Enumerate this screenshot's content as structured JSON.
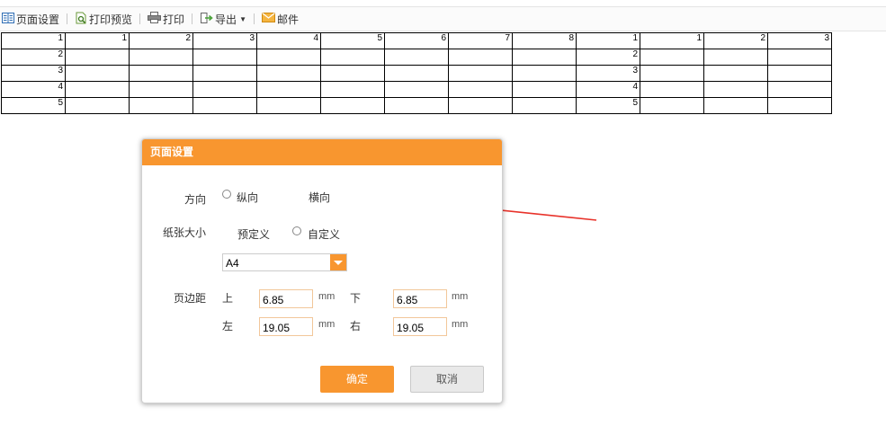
{
  "toolbar": {
    "page_setup": "页面设置",
    "print_preview": "打印预览",
    "print": "打印",
    "export": "导出",
    "mail": "邮件"
  },
  "grid": {
    "rows": [
      [
        "1",
        "1",
        "2",
        "3",
        "4",
        "5",
        "6",
        "7",
        "8",
        "1",
        "1",
        "2",
        "3"
      ],
      [
        "2",
        "",
        "",
        "",
        "",
        "",
        "",
        "",
        "",
        "2",
        "",
        "",
        ""
      ],
      [
        "3",
        "",
        "",
        "",
        "",
        "",
        "",
        "",
        "",
        "3",
        "",
        "",
        ""
      ],
      [
        "4",
        "",
        "",
        "",
        "",
        "",
        "",
        "",
        "",
        "4",
        "",
        "",
        ""
      ],
      [
        "5",
        "",
        "",
        "",
        "",
        "",
        "",
        "",
        "",
        "5",
        "",
        "",
        ""
      ]
    ]
  },
  "dialog": {
    "title": "页面设置",
    "orientation_label": "方向",
    "portrait": "纵向",
    "landscape": "横向",
    "paper_size_label": "纸张大小",
    "predefined": "预定义",
    "custom": "自定义",
    "paper_selected": "A4",
    "margin_label": "页边距",
    "top_label": "上",
    "bottom_label": "下",
    "left_label": "左",
    "right_label": "右",
    "top_value": "6.85",
    "bottom_value": "6.85",
    "left_value": "19.05",
    "right_value": "19.05",
    "unit": "mm",
    "ok": "确定",
    "cancel": "取消"
  },
  "colors": {
    "accent": "#f8962f",
    "annotation_arrow": "#e8322a"
  }
}
